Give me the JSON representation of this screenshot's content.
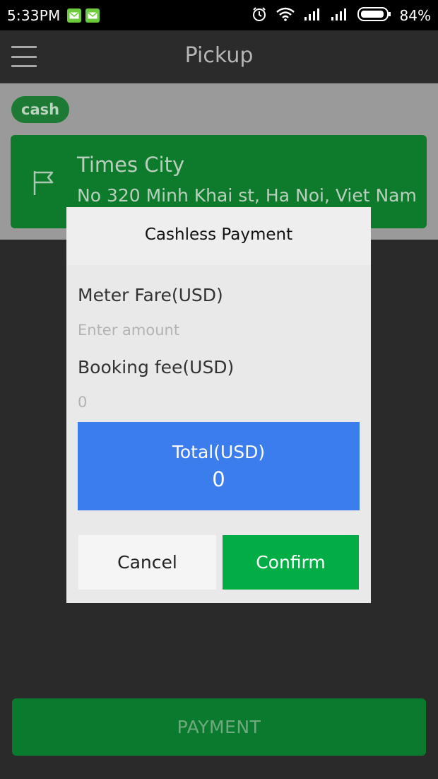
{
  "status_bar": {
    "time": "5:33PM",
    "battery_percent": "84%",
    "icons": [
      "mail-icon",
      "mail-icon",
      "alarm-icon",
      "wifi-icon",
      "signal-icon",
      "signal-icon",
      "battery-icon"
    ]
  },
  "header": {
    "title": "Pickup",
    "menu_icon": "hamburger-menu-icon"
  },
  "trip": {
    "payment_badge": "cash",
    "location_icon": "flag-icon",
    "location_name": "Times City",
    "location_address": "No 320 Minh Khai st, Ha Noi, Viet Nam"
  },
  "dialog": {
    "title": "Cashless Payment",
    "meter_fare_label": "Meter Fare(USD)",
    "meter_fare_value": "",
    "meter_fare_placeholder": "Enter amount",
    "booking_fee_label": "Booking fee(USD)",
    "booking_fee_value": "0",
    "total_label": "Total(USD)",
    "total_value": "0",
    "cancel_label": "Cancel",
    "confirm_label": "Confirm"
  },
  "footer": {
    "payment_label": "PAYMENT"
  },
  "colors": {
    "accent_green": "#03ad45",
    "card_green": "#0d7a2c",
    "total_blue": "#3b7ded",
    "background_dark": "#2a2a2a"
  }
}
